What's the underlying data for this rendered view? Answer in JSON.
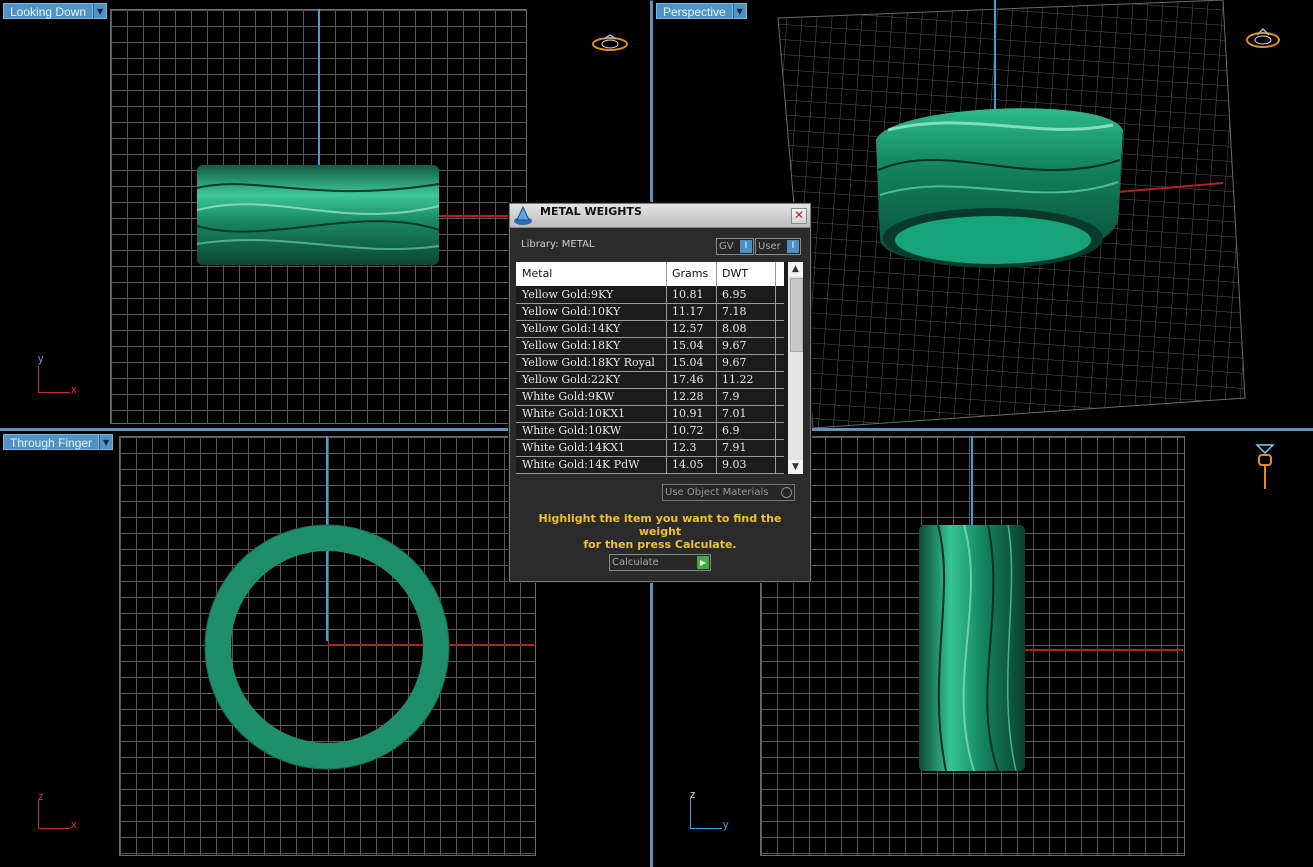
{
  "viewports": {
    "top_left": {
      "label": "Looking Down",
      "axis_v": "y",
      "axis_h": "x"
    },
    "top_right": {
      "label": "Perspective"
    },
    "bottom_left": {
      "label": "Through Finger",
      "axis_v": "z",
      "axis_h": "x"
    },
    "bottom_right": {
      "axis_v": "z",
      "axis_h": "y"
    }
  },
  "dialog": {
    "title": "METAL WEIGHTS",
    "library_label": "Library: METAL",
    "gv_label": "GV",
    "user_label": "User",
    "toggle_indicator": "I",
    "columns": {
      "metal": "Metal",
      "grams": "Grams",
      "dwt": "DWT"
    },
    "rows": [
      {
        "metal": "Yellow Gold:9KY",
        "grams": "10.81",
        "dwt": "6.95"
      },
      {
        "metal": "Yellow Gold:10KY",
        "grams": "11.17",
        "dwt": "7.18"
      },
      {
        "metal": "Yellow Gold:14KY",
        "grams": "12.57",
        "dwt": "8.08"
      },
      {
        "metal": "Yellow Gold:18KY",
        "grams": "15.04",
        "dwt": "9.67"
      },
      {
        "metal": "Yellow Gold:18KY Royal",
        "grams": "15.04",
        "dwt": "9.67"
      },
      {
        "metal": "Yellow Gold:22KY",
        "grams": "17.46",
        "dwt": "11.22"
      },
      {
        "metal": "White Gold:9KW",
        "grams": "12.28",
        "dwt": "7.9"
      },
      {
        "metal": "White Gold:10KX1",
        "grams": "10.91",
        "dwt": "7.01"
      },
      {
        "metal": "White Gold:10KW",
        "grams": "10.72",
        "dwt": "6.9"
      },
      {
        "metal": "White Gold:14KX1",
        "grams": "12.3",
        "dwt": "7.91"
      },
      {
        "metal": "White Gold:14K PdW",
        "grams": "14.05",
        "dwt": "9.03"
      }
    ],
    "use_object_materials": "Use Object Materials",
    "hint_line1": "Highlight the item you want to find the weight",
    "hint_line2": "for then press Calculate.",
    "calculate_label": "Calculate"
  },
  "colors": {
    "viewport_tab": "#4f93c4",
    "ring_green": "#1e8f6a",
    "hint_text": "#f0c02e",
    "grid_line": "#585858",
    "axis_red": "#b0201c",
    "axis_blue": "#3fa0d8"
  }
}
